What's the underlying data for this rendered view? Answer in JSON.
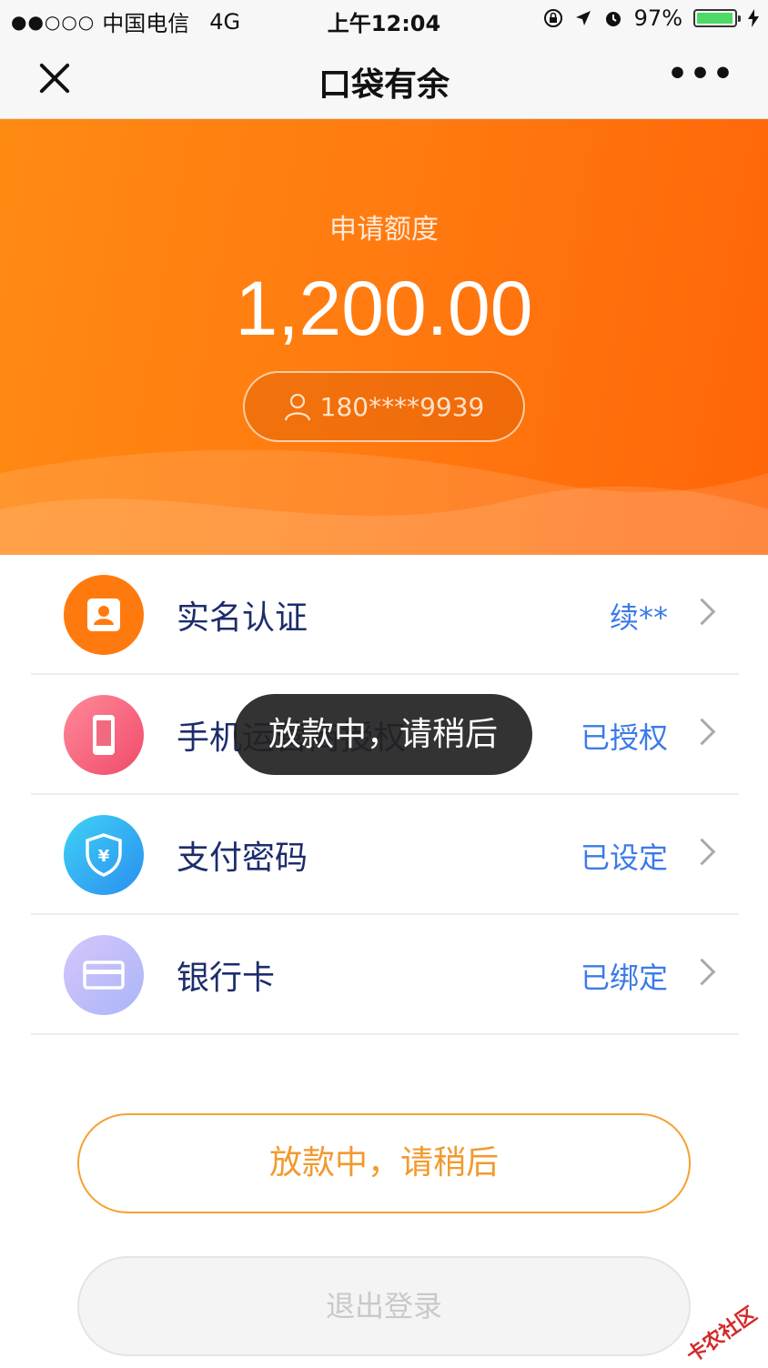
{
  "status_bar": {
    "signal": "●●○○○",
    "carrier": "中国电信",
    "network": "4G",
    "time": "上午12:04",
    "battery_percent": "97%",
    "battery_level": 0.97
  },
  "nav": {
    "title": "口袋有余",
    "more": "•••"
  },
  "hero": {
    "label": "申请额度",
    "amount": "1,200.00",
    "phone": "180****9939"
  },
  "list": [
    {
      "label": "实名认证",
      "status": "续**",
      "icon": "id-card-icon"
    },
    {
      "label": "手机运营商授权",
      "status": "已授权",
      "icon": "phone-icon"
    },
    {
      "label": "支付密码",
      "status": "已设定",
      "icon": "shield-yen-icon"
    },
    {
      "label": "银行卡",
      "status": "已绑定",
      "icon": "bank-card-icon"
    }
  ],
  "toast": "放款中，请稍后",
  "buttons": {
    "primary": "放款中，请稍后",
    "logout": "退出登录"
  },
  "watermark": "卡农社区",
  "colors": {
    "orange": "#ff7a10",
    "status_blue": "#3b7be8",
    "label_navy": "#1c2d6b"
  }
}
